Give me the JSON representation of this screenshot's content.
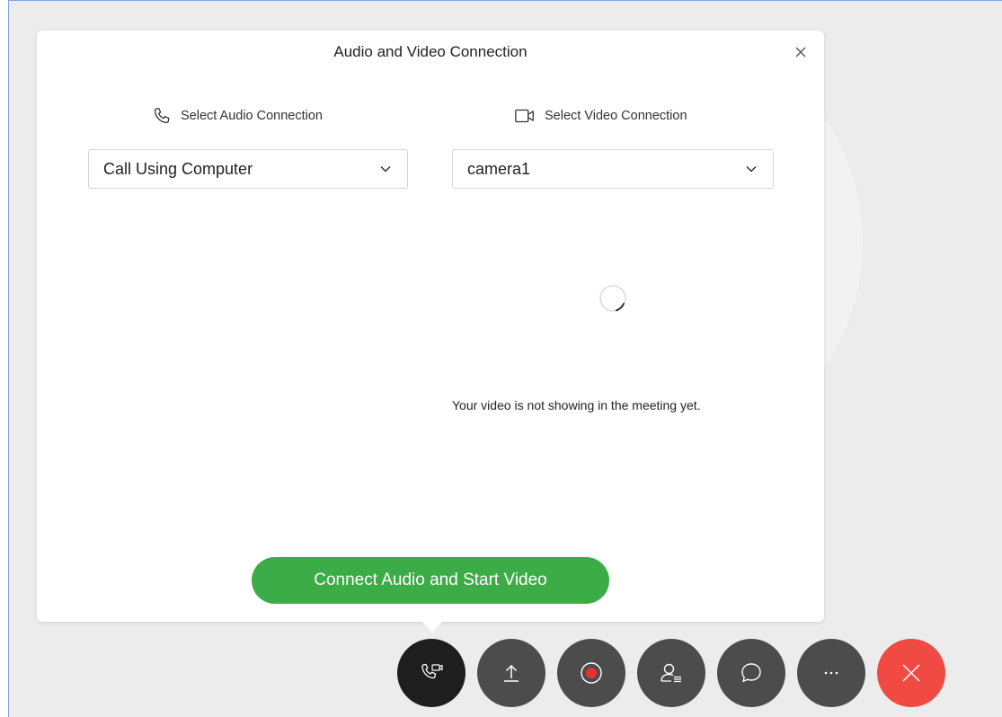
{
  "dialog": {
    "title": "Audio and Video Connection",
    "audio": {
      "heading": "Select Audio Connection",
      "selected": "Call Using Computer"
    },
    "video": {
      "heading": "Select Video Connection",
      "selected": "camera1",
      "status_message": "Your video is not showing in the meeting yet."
    },
    "connect_label": "Connect Audio and Start Video"
  },
  "toolbar": {
    "buttons": [
      {
        "icon": "audio-video-icon",
        "state": "active"
      },
      {
        "icon": "share-icon"
      },
      {
        "icon": "record-icon"
      },
      {
        "icon": "participants-icon"
      },
      {
        "icon": "chat-icon"
      },
      {
        "icon": "more-icon"
      },
      {
        "icon": "end-call-icon"
      }
    ]
  },
  "colors": {
    "primary_green": "#3cac47",
    "end_call_red": "#f04a43",
    "toolbar_button": "#4c4c4c",
    "toolbar_active": "#1e1e1e",
    "record_dot": "#e5322d"
  }
}
